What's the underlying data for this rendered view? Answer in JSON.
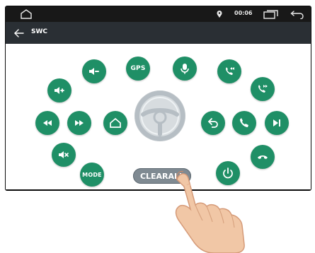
{
  "statusbar": {
    "time": "00:06"
  },
  "titlebar": {
    "title": "SWC"
  },
  "buttons": {
    "gps_label": "GPS",
    "mode_label": "MODE"
  },
  "clear_all": {
    "label": "CLEARALL"
  },
  "icons": {
    "home": "home-icon",
    "location": "location-pin-icon",
    "back": "back-arrow-icon",
    "recent": "recent-apps-icon"
  },
  "colors": {
    "accent": "#1f8f66",
    "statusbar_bg": "#181818",
    "titlebar_bg": "#2a2f34",
    "clear_all_bg": "#7f8a92"
  }
}
